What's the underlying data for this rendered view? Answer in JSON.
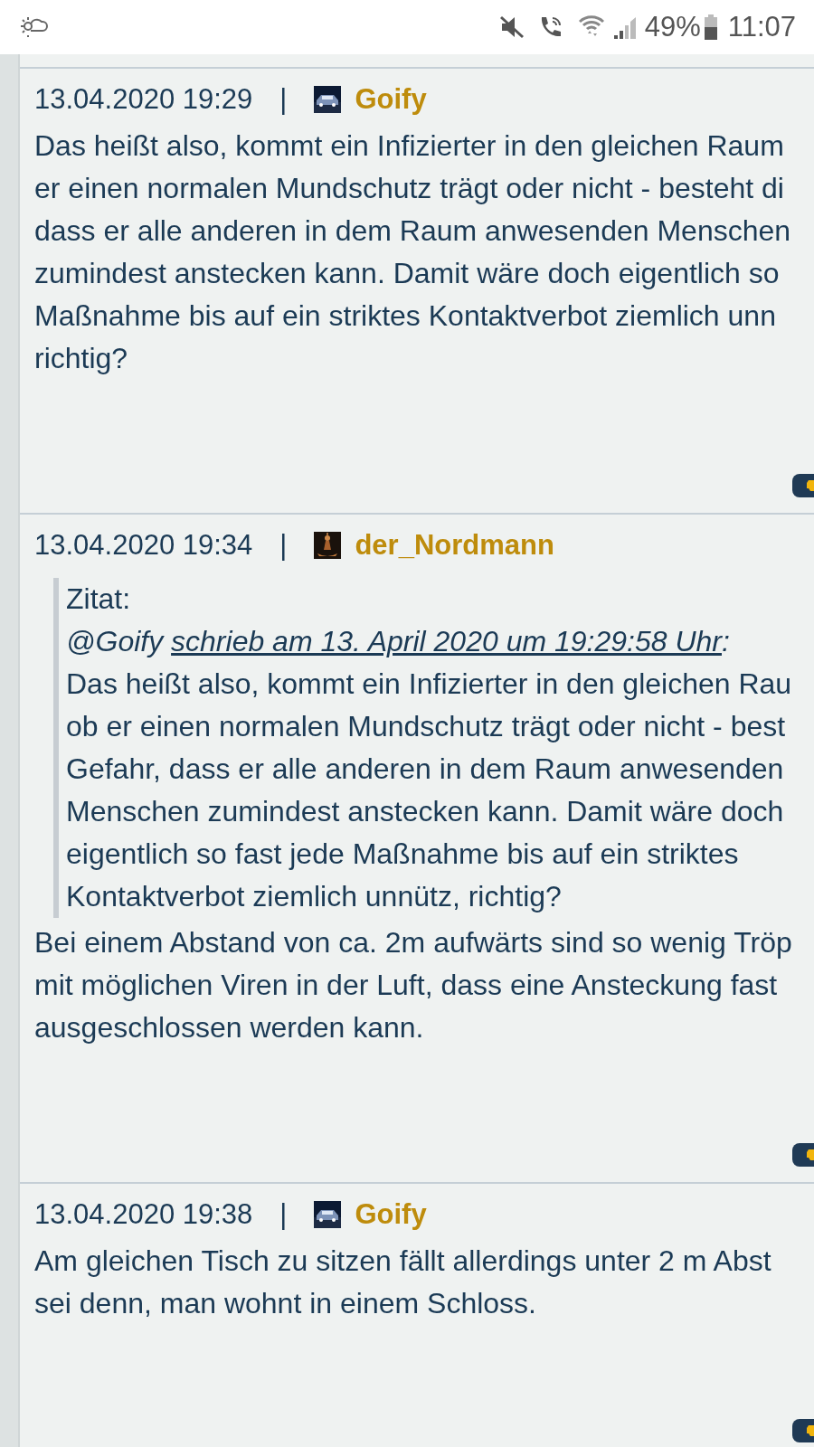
{
  "status_bar": {
    "battery": "49%",
    "time": "11:07"
  },
  "posts": [
    {
      "date": "13.04.2020 19:29",
      "separator": "|",
      "author": "Goify",
      "avatar": {
        "kind": "picture"
      },
      "body": [
        "Das heißt also, kommt ein Infizierter in den gleichen Raum",
        "er einen normalen Mundschutz trägt oder nicht - besteht di",
        "dass er alle anderen in dem Raum anwesenden Menschen",
        "zumindest anstecken kann. Damit wäre doch eigentlich so",
        "Maßnahme bis auf ein striktes Kontaktverbot ziemlich unn",
        "richtig?"
      ]
    },
    {
      "date": "13.04.2020 19:34",
      "separator": "|",
      "author": "der_Nordmann",
      "avatar": {
        "kind": "picture"
      },
      "quote": {
        "label": "Zitat:",
        "mention": "@Goify",
        "link": "schrieb am 13. April 2020 um 19:29:58 Uhr",
        "colon": ":",
        "lines": [
          "Das heißt also, kommt ein Infizierter in den gleichen Rau",
          "ob er einen normalen Mundschutz trägt oder nicht - best",
          "Gefahr, dass er alle anderen in dem Raum anwesenden",
          "Menschen zumindest anstecken kann. Damit wäre doch",
          "eigentlich so fast jede Maßnahme bis auf ein striktes",
          "Kontaktverbot ziemlich unnütz, richtig?"
        ]
      },
      "body": [
        "Bei einem Abstand von ca. 2m aufwärts sind so wenig Tröp",
        "mit möglichen Viren in der Luft, dass eine Ansteckung fast",
        "ausgeschlossen werden kann."
      ]
    },
    {
      "date": "13.04.2020 19:38",
      "separator": "|",
      "author": "Goify",
      "avatar": {
        "kind": "picture"
      },
      "body": [
        "Am gleichen Tisch zu sitzen fällt allerdings unter 2 m Abst",
        "sei denn, man wohnt in einem Schloss."
      ]
    }
  ]
}
